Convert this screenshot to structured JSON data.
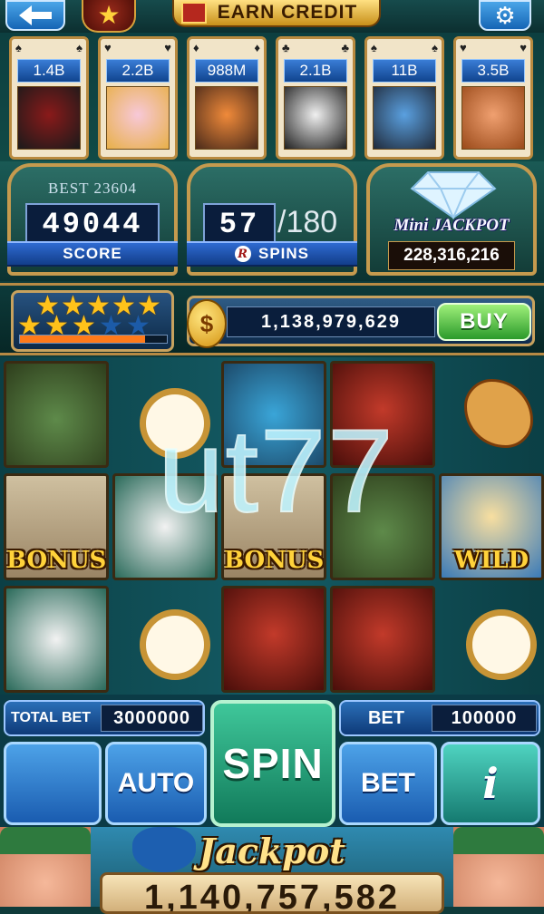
{
  "header": {
    "earn_label": "EARN CREDIT",
    "back_icon": "back-arrow-icon",
    "settings_icon": "gear-icon"
  },
  "friends": [
    {
      "amount": "1.4B",
      "suit": "♠"
    },
    {
      "amount": "2.2B",
      "suit": "♥"
    },
    {
      "amount": "988M",
      "suit": "♦"
    },
    {
      "amount": "2.1B",
      "suit": "♣"
    },
    {
      "amount": "11B",
      "suit": "♠"
    },
    {
      "amount": "3.5B",
      "suit": "♥"
    }
  ],
  "score": {
    "best_label": "BEST",
    "best_value": "23604",
    "value": "49044",
    "label": "SCORE"
  },
  "spins": {
    "current": "57",
    "total": "/180",
    "label": "SPINS",
    "logo": "R"
  },
  "mini_jackpot": {
    "title": "Mini JACKPOT",
    "value": "228,316,216"
  },
  "level": {
    "stars_filled": 8,
    "stars_total": 10,
    "xp_progress": 0.85
  },
  "coins": {
    "balance": "1,138,979,629",
    "buy_label": "BUY",
    "coin_symbol": "$"
  },
  "reels": {
    "bonus_label": "BONUS",
    "wild_label": "WILD"
  },
  "watermark": "ut77",
  "controls": {
    "total_bet_label": "TOTAL BET",
    "total_bet_value": "3000000",
    "bet_label": "BET",
    "bet_value": "100000",
    "spin_label": "SPIN",
    "auto_label": "AUTO",
    "bet_button_label": "BET",
    "info_label": "i"
  },
  "jackpot": {
    "title": "Jackpot",
    "value": "1,140,757,582"
  },
  "colors": {
    "accent_blue": "#1565b5",
    "spin_green": "#117a5a",
    "buy_green": "#2b9a2b",
    "gold": "#ffd23a"
  }
}
